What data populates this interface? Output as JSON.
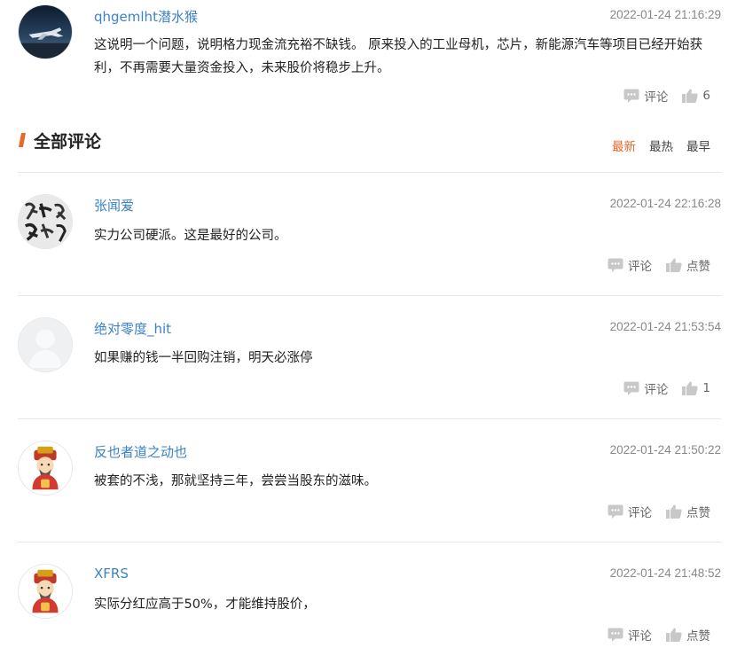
{
  "top_comment": {
    "username": "qhgemlht潜水猴",
    "time": "2022-01-24 21:16:29",
    "text": "这说明一个问题，说明格力现金流充裕不缺钱。 原来投入的工业母机，芯片，新能源汽车等项目已经开始获利，不再需要大量资金投入，未来股价将稳步上升。",
    "reply_label": "评论",
    "like_label": "6"
  },
  "section": {
    "title": "全部评论",
    "sort_options": [
      "最新",
      "最热",
      "最早"
    ],
    "active_sort": "最新"
  },
  "comments": [
    {
      "username": "张闻爱",
      "time": "2022-01-24 22:16:28",
      "text": "实力公司硬派。这是最好的公司。",
      "reply_label": "评论",
      "like_label": "点赞",
      "avatar": "calligraphy"
    },
    {
      "username": "绝对零度_hit",
      "time": "2022-01-24 21:53:54",
      "text": "如果赚的钱一半回购注销，明天必涨停",
      "reply_label": "评论",
      "like_label": "1",
      "avatar": "default-user"
    },
    {
      "username": "反也者道之动也",
      "time": "2022-01-24 21:50:22",
      "text": "被套的不浅，那就坚持三年，尝尝当股东的滋味。",
      "reply_label": "评论",
      "like_label": "点赞",
      "avatar": "fortune-god"
    },
    {
      "username": "XFRS",
      "time": "2022-01-24 21:48:52",
      "text": "实际分红应高于50%，才能维持股价，",
      "reply_label": "评论",
      "like_label": "点赞",
      "avatar": "fortune-god"
    }
  ],
  "colors": {
    "username": "#3b82c8",
    "accent": "#e8682b",
    "icon": "#c8c8c8",
    "divider": "#e6e6e6"
  }
}
